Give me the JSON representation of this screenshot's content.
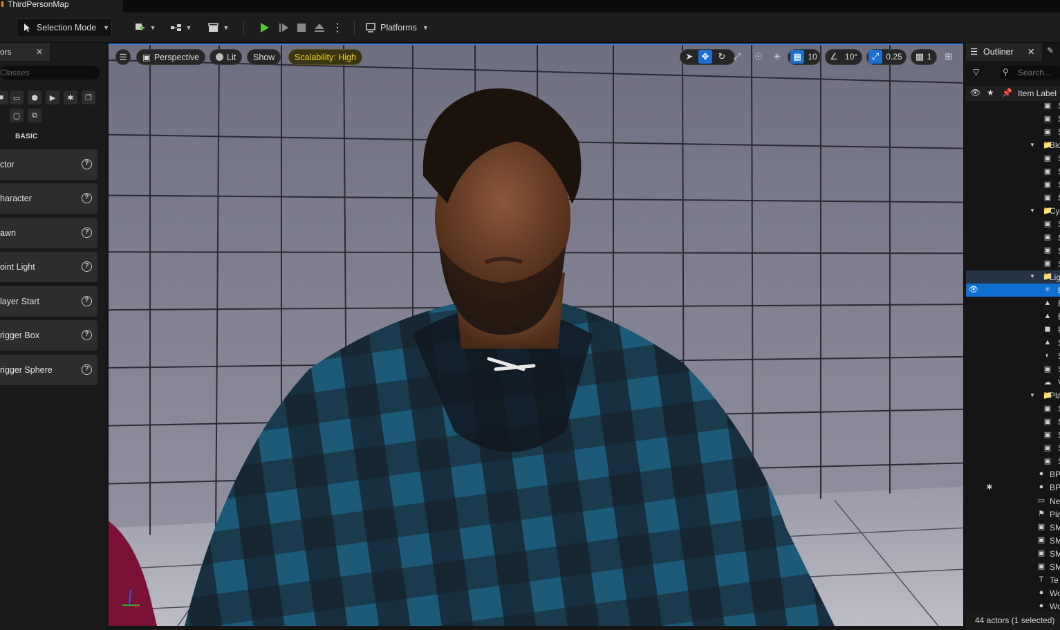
{
  "window": {
    "tab_title": "ThirdPersonMap"
  },
  "toolbar": {
    "selection_mode": "Selection Mode",
    "platforms": "Platforms"
  },
  "place_actors": {
    "tab_label": "ors",
    "search_placeholder": "Classes",
    "category_label": "BASIC",
    "items": [
      {
        "label": "ctor"
      },
      {
        "label": "haracter"
      },
      {
        "label": "awn"
      },
      {
        "label": "oint Light"
      },
      {
        "label": "layer Start"
      },
      {
        "label": "rigger Box"
      },
      {
        "label": "rigger Sphere"
      }
    ]
  },
  "viewport": {
    "perspective": "Perspective",
    "lit": "Lit",
    "show": "Show",
    "scalability": "Scalability: High",
    "grid_snap": "10",
    "rotation_snap": "10°",
    "scale_snap": "0.25",
    "camera_speed": "1"
  },
  "outliner": {
    "tab_label": "Outliner",
    "search_placeholder": "Search...",
    "column_label": "Item Label",
    "rows": [
      {
        "icon": "mesh",
        "label": "S",
        "indent": 2
      },
      {
        "icon": "mesh",
        "label": "S",
        "indent": 2
      },
      {
        "icon": "mesh",
        "label": "S",
        "indent": 2
      },
      {
        "icon": "folder",
        "label": "Blo",
        "indent": 1
      },
      {
        "icon": "mesh",
        "label": "S",
        "indent": 2
      },
      {
        "icon": "mesh",
        "label": "S",
        "indent": 2
      },
      {
        "icon": "mesh",
        "label": "S",
        "indent": 2
      },
      {
        "icon": "mesh",
        "label": "S",
        "indent": 2
      },
      {
        "icon": "folder",
        "label": "Cy",
        "indent": 1
      },
      {
        "icon": "mesh",
        "label": "S",
        "indent": 2
      },
      {
        "icon": "mesh",
        "label": "S",
        "indent": 2
      },
      {
        "icon": "mesh",
        "label": "S",
        "indent": 2
      },
      {
        "icon": "mesh",
        "label": "S",
        "indent": 2
      },
      {
        "icon": "folder",
        "label": "Lig",
        "indent": 1,
        "state": "folder-sel"
      },
      {
        "icon": "light",
        "label": "D",
        "indent": 2,
        "state": "sel"
      },
      {
        "icon": "fog",
        "label": "E",
        "indent": 2
      },
      {
        "icon": "sky",
        "label": "E",
        "indent": 2
      },
      {
        "icon": "volume",
        "label": "P",
        "indent": 2
      },
      {
        "icon": "skylight",
        "label": "S",
        "indent": 2
      },
      {
        "icon": "atmos",
        "label": "S",
        "indent": 2
      },
      {
        "icon": "mesh",
        "label": "S",
        "indent": 2
      },
      {
        "icon": "cloud",
        "label": "V",
        "indent": 2
      },
      {
        "icon": "folder",
        "label": "Pla",
        "indent": 1
      },
      {
        "icon": "mesh",
        "label": "S",
        "indent": 2
      },
      {
        "icon": "mesh",
        "label": "S",
        "indent": 2
      },
      {
        "icon": "mesh",
        "label": "S",
        "indent": 2
      },
      {
        "icon": "mesh",
        "label": "S",
        "indent": 2
      },
      {
        "icon": "mesh",
        "label": "S",
        "indent": 2
      },
      {
        "icon": "pawn",
        "label": "BP",
        "indent": 0
      },
      {
        "icon": "pawn",
        "label": "BP",
        "indent": 0,
        "starred": true
      },
      {
        "icon": "clapper",
        "label": "Ne",
        "indent": 0
      },
      {
        "icon": "flag",
        "label": "Pla",
        "indent": 0
      },
      {
        "icon": "mesh",
        "label": "SM",
        "indent": 0
      },
      {
        "icon": "mesh",
        "label": "SM",
        "indent": 0
      },
      {
        "icon": "mesh",
        "label": "SM",
        "indent": 0
      },
      {
        "icon": "mesh",
        "label": "SM",
        "indent": 0
      },
      {
        "icon": "text",
        "label": "Te",
        "indent": 0
      },
      {
        "icon": "pawn",
        "label": "Wo",
        "indent": 0
      },
      {
        "icon": "pawn",
        "label": "Wo",
        "indent": 0
      }
    ],
    "status": "44 actors (1 selected)"
  }
}
